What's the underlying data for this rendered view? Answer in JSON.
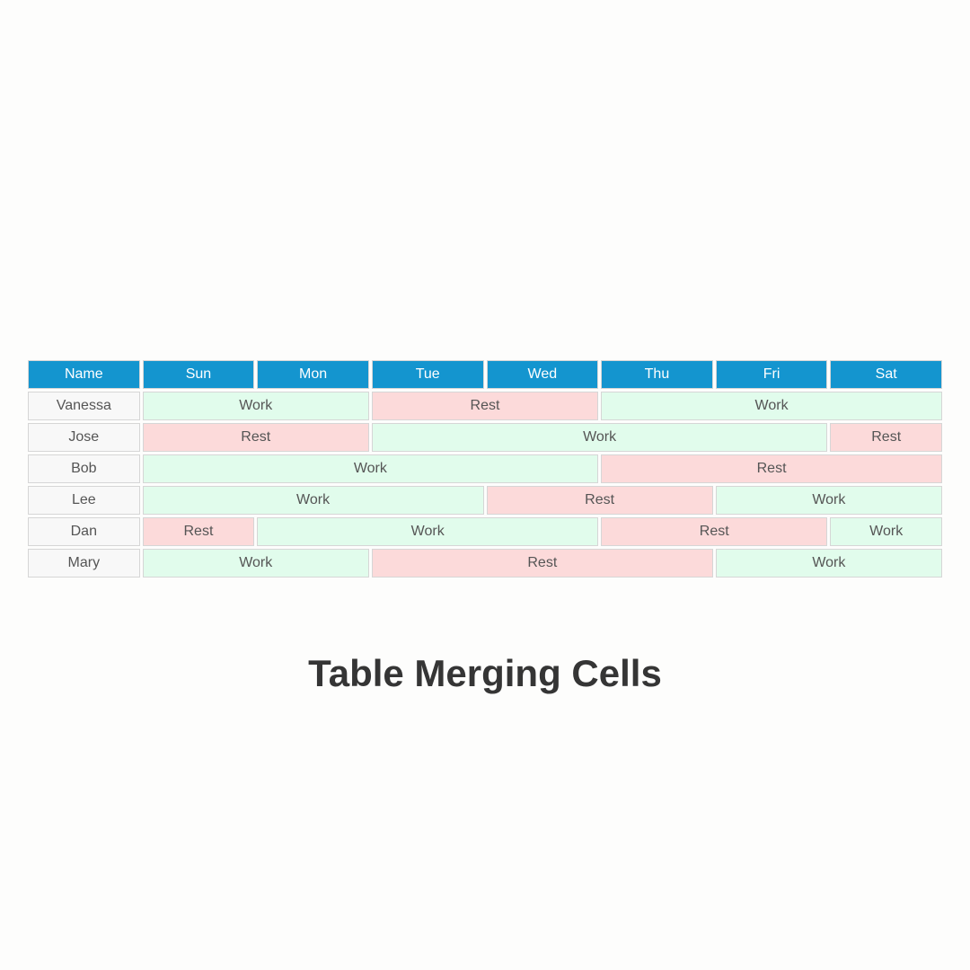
{
  "title": "Table Merging Cells",
  "headers": [
    "Name",
    "Sun",
    "Mon",
    "Tue",
    "Wed",
    "Thu",
    "Fri",
    "Sat"
  ],
  "rows": [
    {
      "name": "Vanessa",
      "cells": [
        {
          "label": "Work",
          "span": 2,
          "type": "work"
        },
        {
          "label": "Rest",
          "span": 2,
          "type": "rest"
        },
        {
          "label": "Work",
          "span": 3,
          "type": "work"
        }
      ]
    },
    {
      "name": "Jose",
      "cells": [
        {
          "label": "Rest",
          "span": 2,
          "type": "rest"
        },
        {
          "label": "Work",
          "span": 4,
          "type": "work"
        },
        {
          "label": "Rest",
          "span": 1,
          "type": "rest"
        }
      ]
    },
    {
      "name": "Bob",
      "cells": [
        {
          "label": "Work",
          "span": 4,
          "type": "work"
        },
        {
          "label": "Rest",
          "span": 3,
          "type": "rest"
        }
      ]
    },
    {
      "name": "Lee",
      "cells": [
        {
          "label": "Work",
          "span": 3,
          "type": "work"
        },
        {
          "label": "Rest",
          "span": 2,
          "type": "rest"
        },
        {
          "label": "Work",
          "span": 2,
          "type": "work"
        }
      ]
    },
    {
      "name": "Dan",
      "cells": [
        {
          "label": "Rest",
          "span": 1,
          "type": "rest"
        },
        {
          "label": "Work",
          "span": 3,
          "type": "work"
        },
        {
          "label": "Rest",
          "span": 2,
          "type": "rest"
        },
        {
          "label": "Work",
          "span": 1,
          "type": "work"
        }
      ]
    },
    {
      "name": "Mary",
      "cells": [
        {
          "label": "Work",
          "span": 2,
          "type": "work"
        },
        {
          "label": "Rest",
          "span": 3,
          "type": "rest"
        },
        {
          "label": "Work",
          "span": 2,
          "type": "work"
        }
      ]
    }
  ]
}
